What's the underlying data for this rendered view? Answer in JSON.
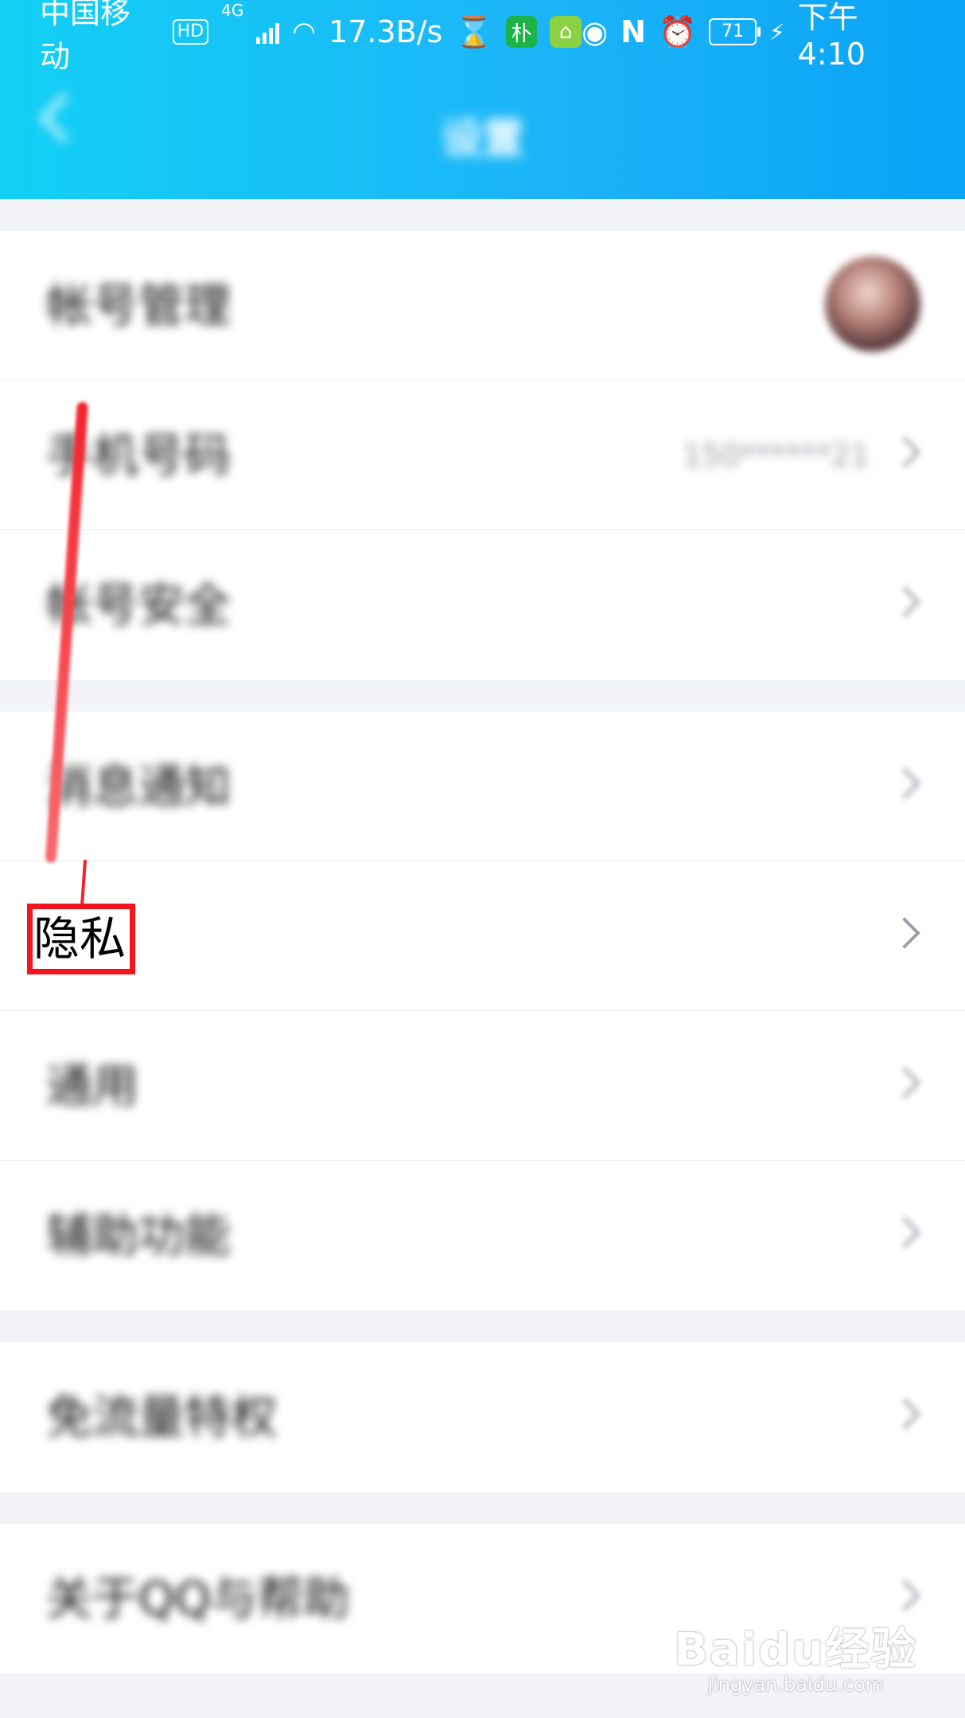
{
  "status_bar": {
    "carrier": "中国移动",
    "hd": "HD",
    "network": "4G",
    "speed": "17.3B/s",
    "app_badge_1": "朴",
    "battery": "71",
    "time": "下午4:10"
  },
  "nav": {
    "title": "设置"
  },
  "groups": [
    {
      "items": [
        {
          "label": "帐号管理",
          "value": ""
        },
        {
          "label": "手机号码",
          "value": "150******21"
        },
        {
          "label": "帐号安全",
          "value": ""
        }
      ]
    },
    {
      "items": [
        {
          "label": "消息通知",
          "value": ""
        },
        {
          "label": "隐私",
          "value": ""
        },
        {
          "label": "通用",
          "value": ""
        },
        {
          "label": "辅助功能",
          "value": ""
        }
      ]
    },
    {
      "items": [
        {
          "label": "免流量特权",
          "value": ""
        }
      ]
    },
    {
      "items": [
        {
          "label": "关于QQ与帮助",
          "value": ""
        }
      ]
    }
  ],
  "highlight": {
    "label": "隐私",
    "color": "#f4141b"
  },
  "watermark": {
    "main": "Baidu经验",
    "sub": "jingyan.baidu.com"
  },
  "colors": {
    "header_start": "#12d0f5",
    "header_end": "#0aa3f6",
    "background": "#f3f4f8"
  }
}
